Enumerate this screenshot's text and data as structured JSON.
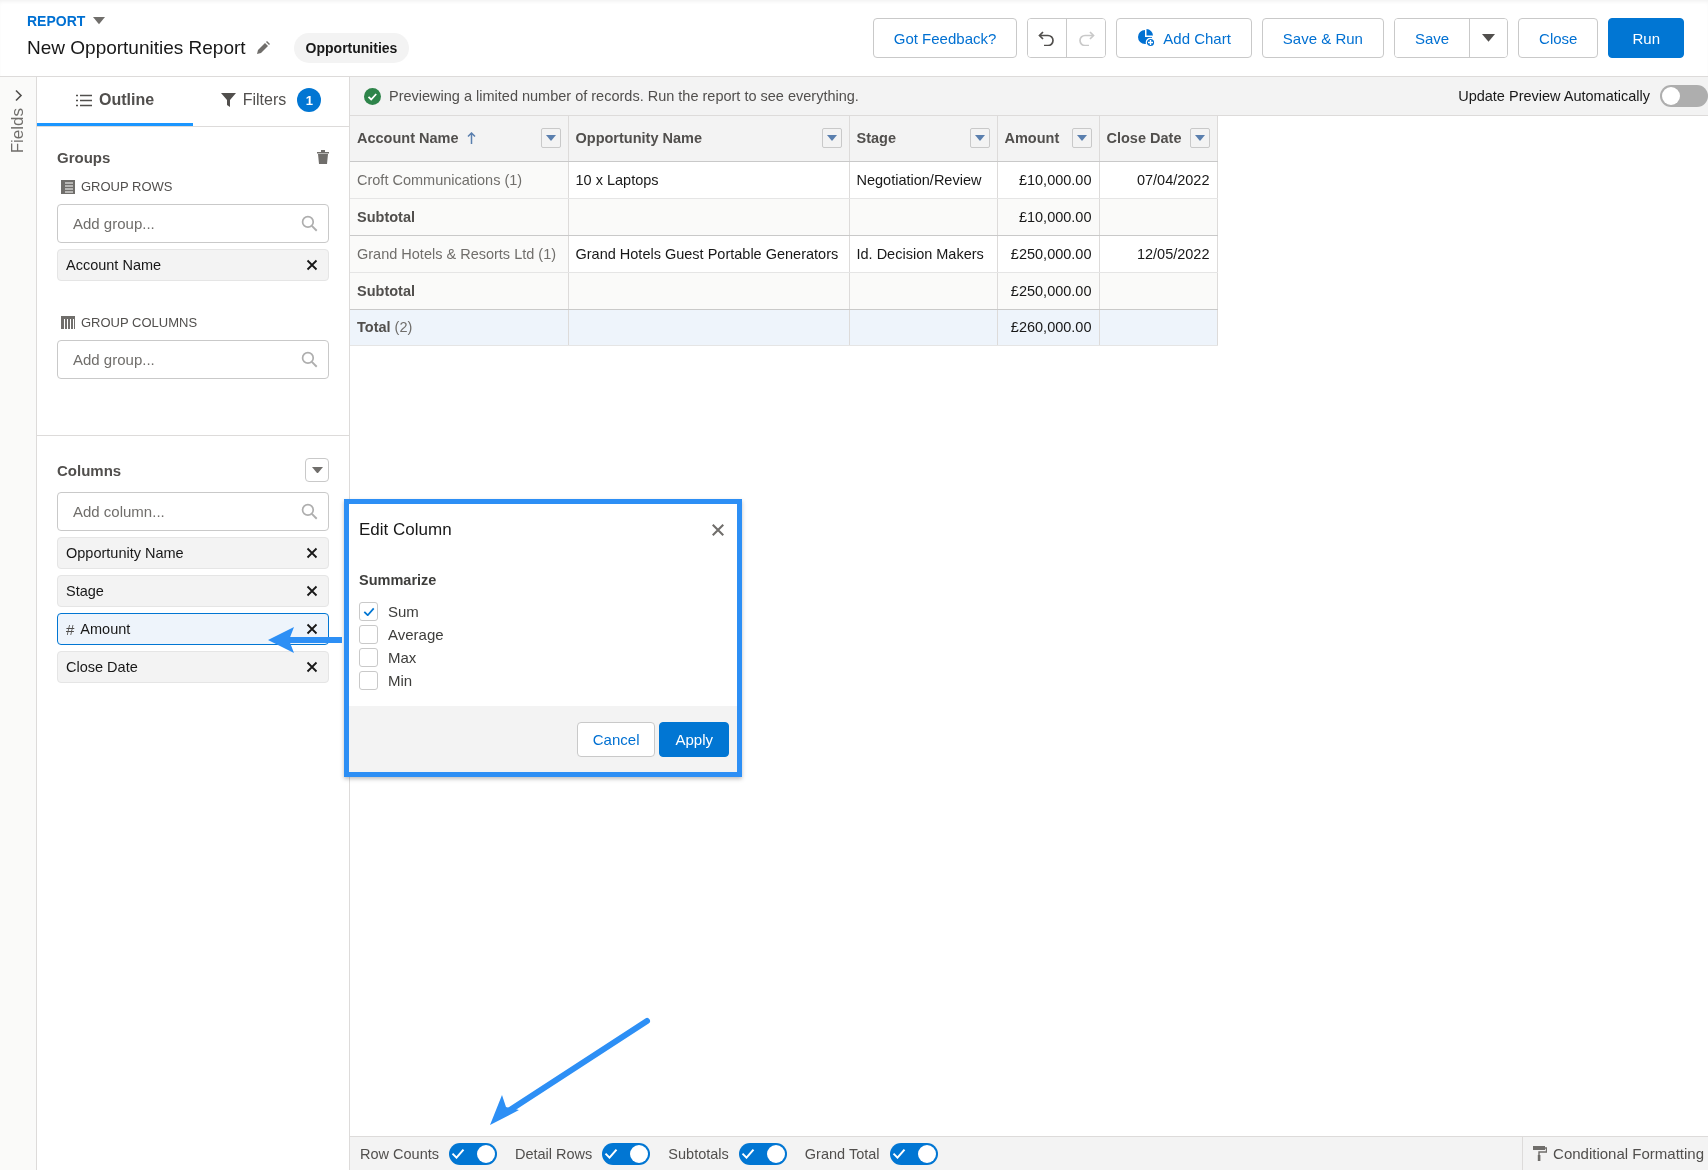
{
  "header": {
    "object_type": "REPORT",
    "title": "New Opportunities Report",
    "report_type": "Opportunities"
  },
  "toolbar": [
    {
      "kind": "text",
      "label": "Got Feedback?"
    },
    {
      "kind": "history",
      "undo_disabled": false,
      "redo_disabled": true
    },
    {
      "kind": "chart",
      "label": "Add Chart"
    },
    {
      "kind": "text",
      "label": "Save & Run"
    },
    {
      "kind": "split",
      "label": "Save"
    },
    {
      "kind": "text",
      "label": "Close"
    },
    {
      "kind": "primary",
      "label": "Run"
    }
  ],
  "side_strip": {
    "label": "Fields"
  },
  "panel": {
    "tabs": [
      {
        "label": "Outline",
        "selected": true
      },
      {
        "label": "Filters",
        "selected": false,
        "badge": "1"
      }
    ],
    "groups": {
      "title": "Groups",
      "rows_label": "GROUP ROWS",
      "rows_placeholder": "Add group...",
      "rows": [
        {
          "label": "Account Name"
        }
      ],
      "columns_label": "GROUP COLUMNS",
      "columns_placeholder": "Add group..."
    },
    "columns": {
      "title": "Columns",
      "placeholder": "Add column...",
      "items": [
        {
          "label": "Opportunity Name",
          "selected": false
        },
        {
          "label": "Stage",
          "selected": false
        },
        {
          "label": "Amount",
          "selected": true,
          "type_symbol": "#"
        },
        {
          "label": "Close Date",
          "selected": false
        }
      ]
    }
  },
  "notice": {
    "text": "Previewing a limited number of records. Run the report to see everything.",
    "auto_update": {
      "label": "Update Preview Automatically",
      "on": false
    }
  },
  "table": {
    "columns": [
      {
        "label": "Account Name",
        "sorted": true
      },
      {
        "label": "Opportunity Name",
        "sorted": false
      },
      {
        "label": "Stage",
        "sorted": false
      },
      {
        "label": "Amount",
        "sorted": false
      },
      {
        "label": "Close Date",
        "sorted": false
      }
    ],
    "rows": [
      {
        "kind": "detail",
        "cells": [
          "Croft Communications (1)",
          "10 x Laptops",
          "Negotiation/Review",
          "£10,000.00",
          "07/04/2022"
        ]
      },
      {
        "kind": "subtotal",
        "cells": [
          "Subtotal",
          "",
          "",
          "£10,000.00",
          ""
        ]
      },
      {
        "kind": "detail",
        "cells": [
          "Grand Hotels & Resorts Ltd (1)",
          "Grand Hotels Guest Portable Generators",
          "Id. Decision Makers",
          "£250,000.00",
          "12/05/2022"
        ]
      },
      {
        "kind": "subtotal",
        "cells": [
          "Subtotal",
          "",
          "",
          "£250,000.00",
          ""
        ]
      },
      {
        "kind": "total",
        "cells": [
          "**Total** (2)",
          "",
          "",
          "£260,000.00",
          ""
        ]
      }
    ]
  },
  "edit_dialog": {
    "title": "Edit Column",
    "section": "Summarize",
    "options": [
      {
        "label": "Sum",
        "checked": true
      },
      {
        "label": "Average",
        "checked": false
      },
      {
        "label": "Max",
        "checked": false
      },
      {
        "label": "Min",
        "checked": false
      }
    ],
    "buttons": [
      {
        "label": "Cancel",
        "kind": "neutral"
      },
      {
        "label": "Apply",
        "kind": "brand"
      }
    ]
  },
  "footer": {
    "toggles": [
      {
        "label": "Row Counts",
        "on": true
      },
      {
        "label": "Detail Rows",
        "on": true
      },
      {
        "label": "Subtotals",
        "on": true
      },
      {
        "label": "Grand Total",
        "on": true
      }
    ],
    "action": "Conditional Formatting"
  }
}
